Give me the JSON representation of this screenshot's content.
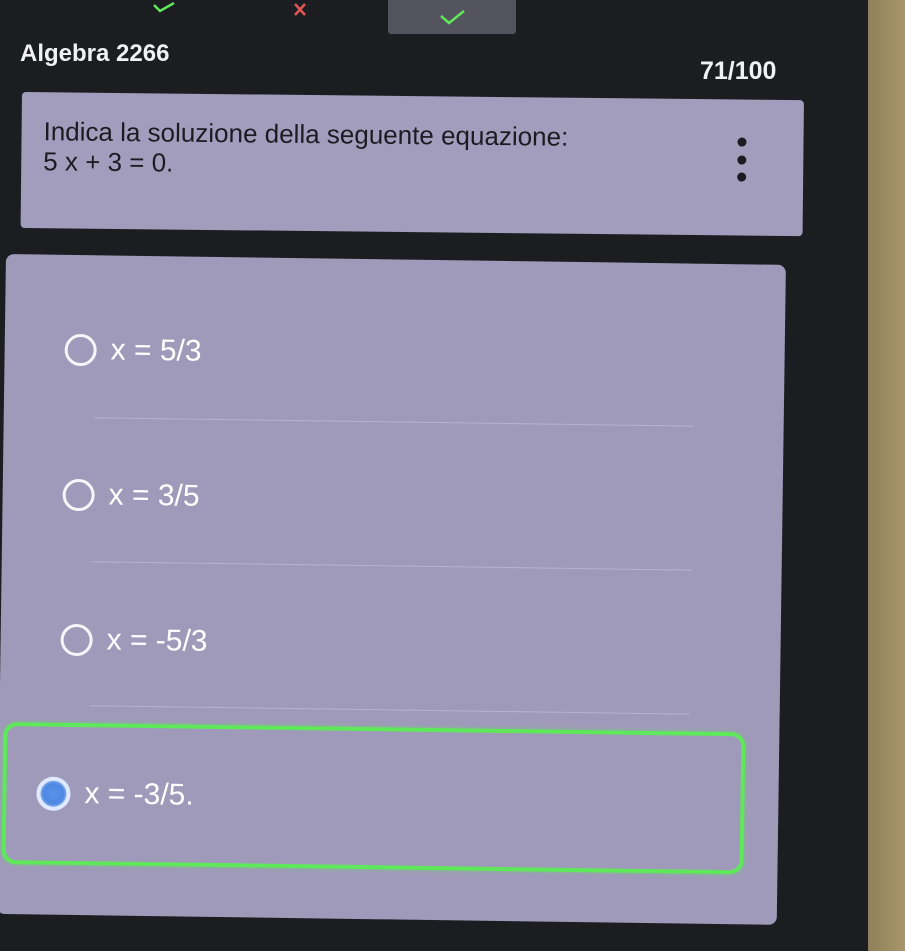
{
  "header": {
    "title": "Algebra 2266",
    "progress": "71/100"
  },
  "question": {
    "prompt": "Indica la soluzione della seguente equazione:",
    "equation": "5 x + 3 = 0."
  },
  "answers": [
    {
      "label": "x = 5/3",
      "selected": false
    },
    {
      "label": "x = 3/5",
      "selected": false
    },
    {
      "label": "x = -5/3",
      "selected": false
    },
    {
      "label": "x = -3/5.",
      "selected": true
    }
  ],
  "colors": {
    "accent_correct": "#5ee85a",
    "accent_wrong": "#e05555",
    "card": "#a09aba",
    "selected_radio": "#4d88e4"
  },
  "icons": {
    "history": [
      "check-icon",
      "cross-icon",
      "check-icon"
    ],
    "menu": "kebab-menu-icon"
  }
}
